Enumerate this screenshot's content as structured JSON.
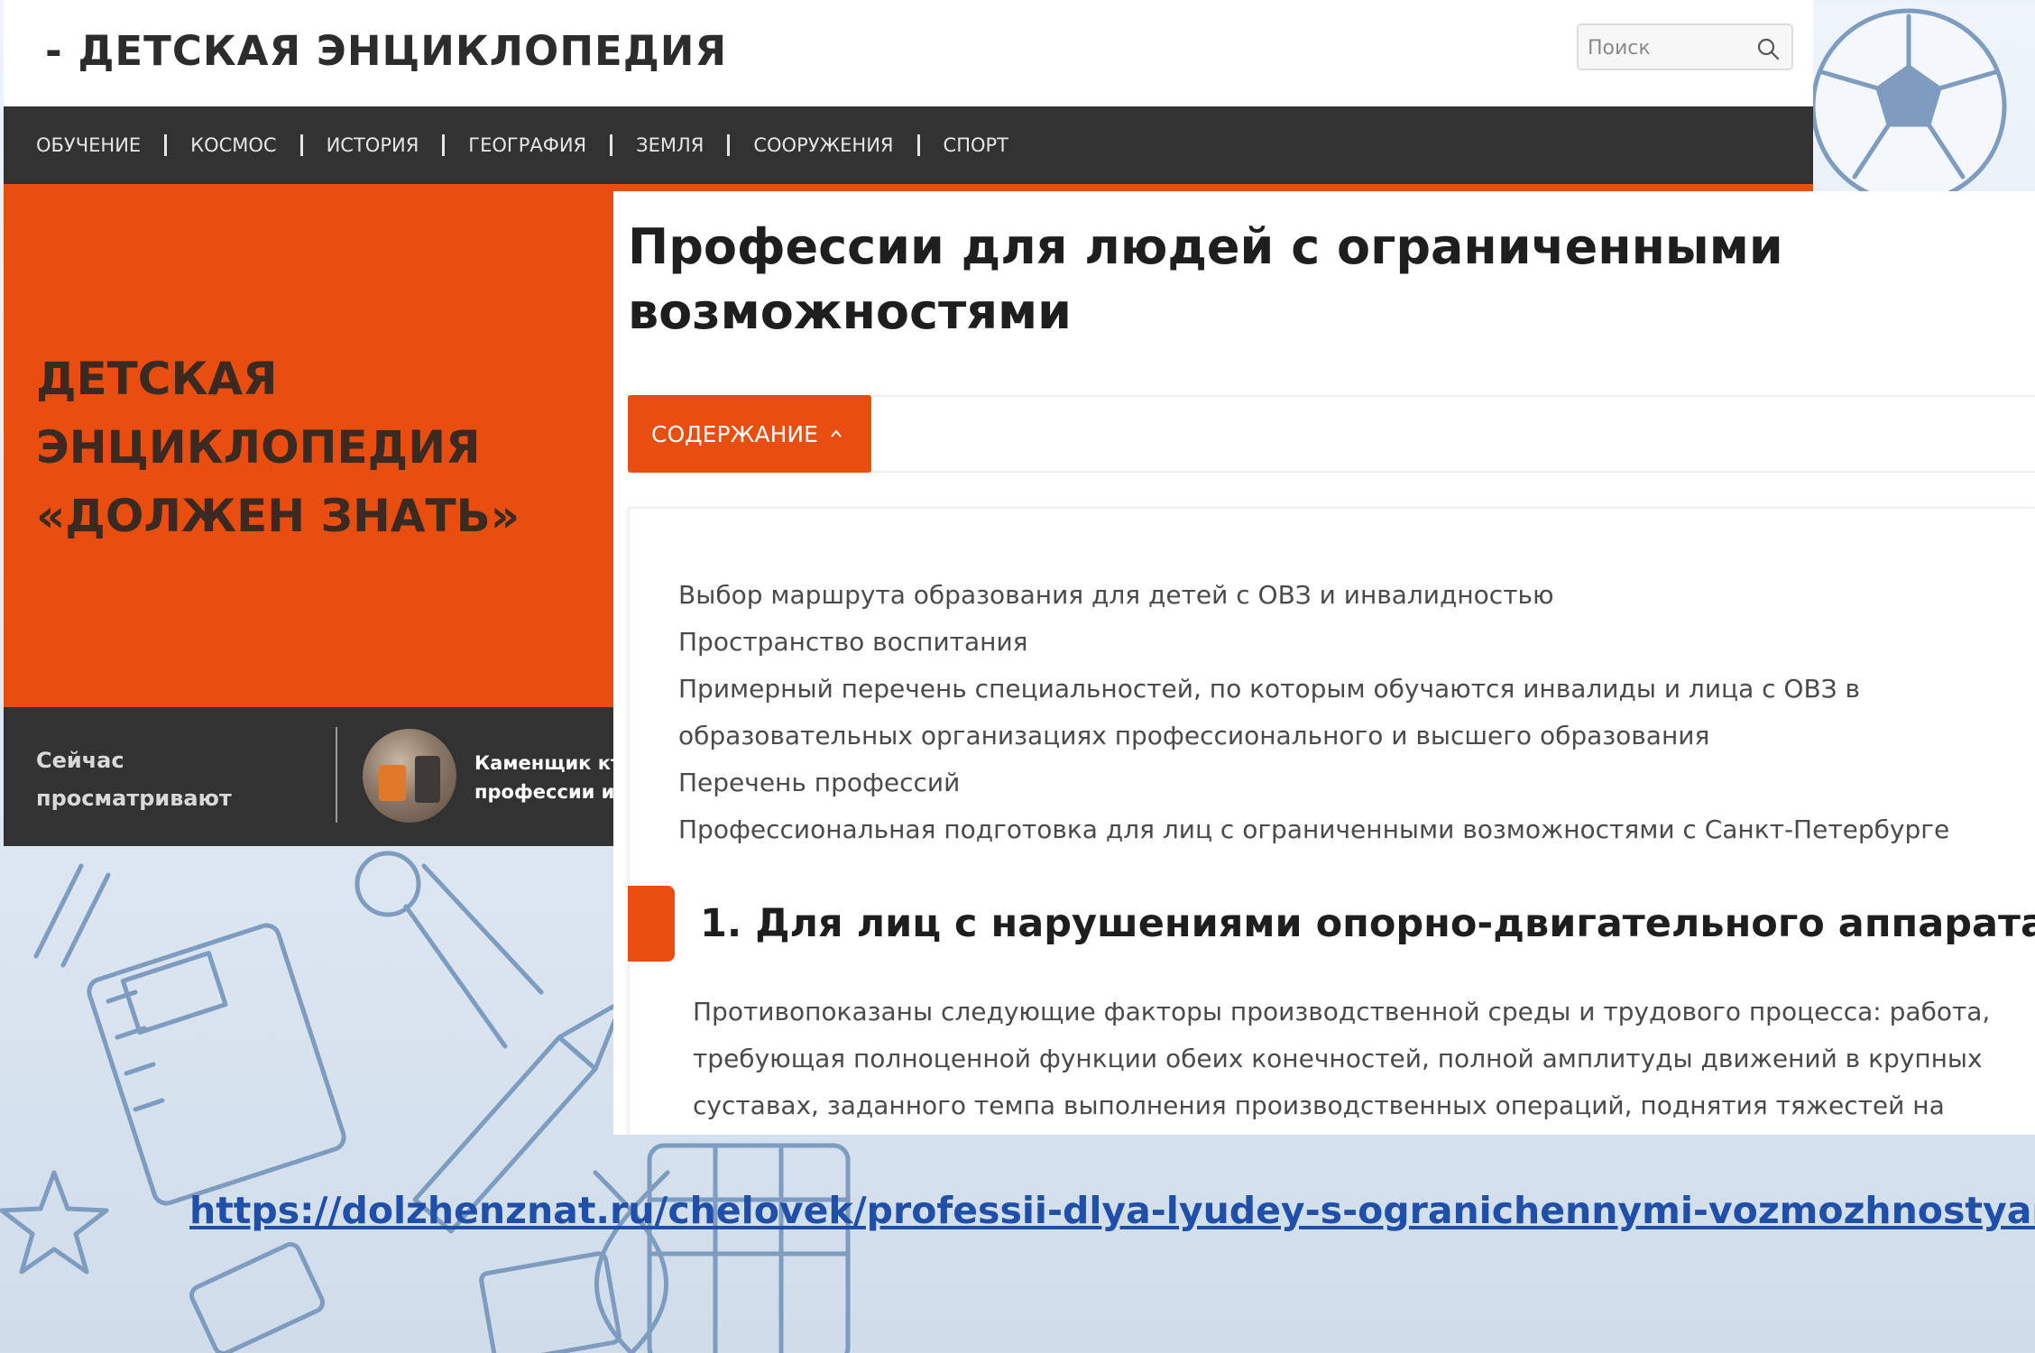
{
  "header": {
    "logo": "- ДЕТСКАЯ ЭНЦИКЛОПЕДИЯ",
    "search_placeholder": "Поиск"
  },
  "nav": {
    "items": [
      "ОБУЧЕНИЕ",
      "КОСМОС",
      "ИСТОРИЯ",
      "ГЕОГРАФИЯ",
      "ЗЕМЛЯ",
      "СООРУЖЕНИЯ",
      "СПОРТ"
    ]
  },
  "banner": {
    "lines": [
      "ДЕТСКАЯ",
      "ЭНЦИКЛОПЕДИЯ",
      "«ДОЛЖЕН ЗНАТЬ»"
    ]
  },
  "now_viewing": {
    "label_lines": [
      "Сейчас",
      "просматривают"
    ],
    "item_lines": [
      "Каменщик кто",
      "профессии и е"
    ]
  },
  "article": {
    "title_lines": [
      "Профессии для людей с ограниченными",
      "возможностями"
    ],
    "toc_button": "СОДЕРЖАНИЕ",
    "toc_items": [
      "Выбор маршрута образования для детей с ОВЗ и инвалидностью",
      "Пространство воспитания",
      "Примерный перечень специальностей, по которым обучаются инвалиды и лица с ОВЗ в",
      "образовательных организациях профессионального и высшего образования",
      "Перечень профессий",
      "Профессиональная подготовка для лиц с ограниченными возможностями с Санкт-Петербурге"
    ],
    "section_heading": "1. Для лиц с нарушениями опорно-двигательного аппарата",
    "body_lines": [
      "Противопоказаны следующие факторы производственной среды и трудового процесса: работа,",
      "требующая полноценной функции обеих конечностей, полной амплитуды движений в крупных",
      "суставах, заданного темпа выполнения производственных операций, поднятия тяжестей на"
    ]
  },
  "link": {
    "url": "https://dolzhenznat.ru/chelovek/professii-dlya-lyudey-s-ogranichennymi-vozmozhnostyami"
  },
  "colors": {
    "accent": "#e84e0f",
    "nav_bg": "#323232",
    "link": "#1f4fa8"
  }
}
